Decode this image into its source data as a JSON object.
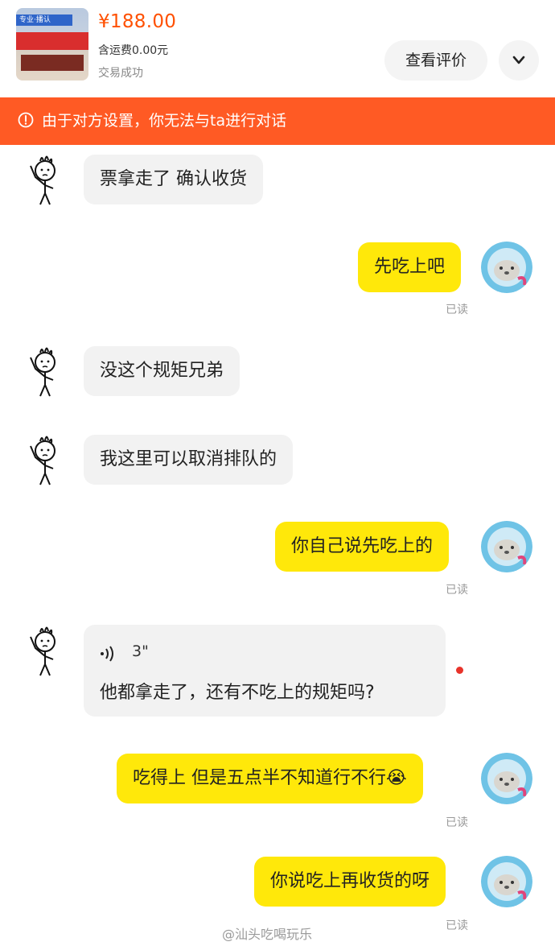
{
  "order": {
    "thumb_tag": "专业·播认",
    "price": "¥188.00",
    "shipping": "含运费0.00元",
    "status": "交易成功",
    "review_button": "查看评价",
    "expand_icon": "chevron-down-icon"
  },
  "notice": {
    "icon": "alert-circle-icon",
    "text": "由于对方设置，你无法与ta进行对话"
  },
  "messages": [
    {
      "side": "left",
      "text": "票拿走了 确认收货"
    },
    {
      "side": "right",
      "text": "先吃上吧",
      "read": "已读"
    },
    {
      "side": "left",
      "text": "没这个规矩兄弟"
    },
    {
      "side": "left",
      "text": "我这里可以取消排队的"
    },
    {
      "side": "right",
      "text": "你自己说先吃上的",
      "read": "已读"
    },
    {
      "side": "left",
      "type": "voice",
      "duration": "3\"",
      "text": "他都拿走了，还有不吃上的规矩吗?",
      "unread_dot": true
    },
    {
      "side": "right",
      "text": "吃得上 但是五点半不知道行不行😭",
      "read": "已读"
    },
    {
      "side": "right",
      "text": "你说吃上再收货的呀",
      "read": "已读"
    }
  ],
  "watermark": "@汕头吃喝玩乐",
  "colors": {
    "price": "#ff5000",
    "notice_bg": "#ff5a24",
    "my_bubble": "#ffe80a",
    "their_bubble": "#f2f2f2",
    "unread_dot": "#e8332a"
  }
}
